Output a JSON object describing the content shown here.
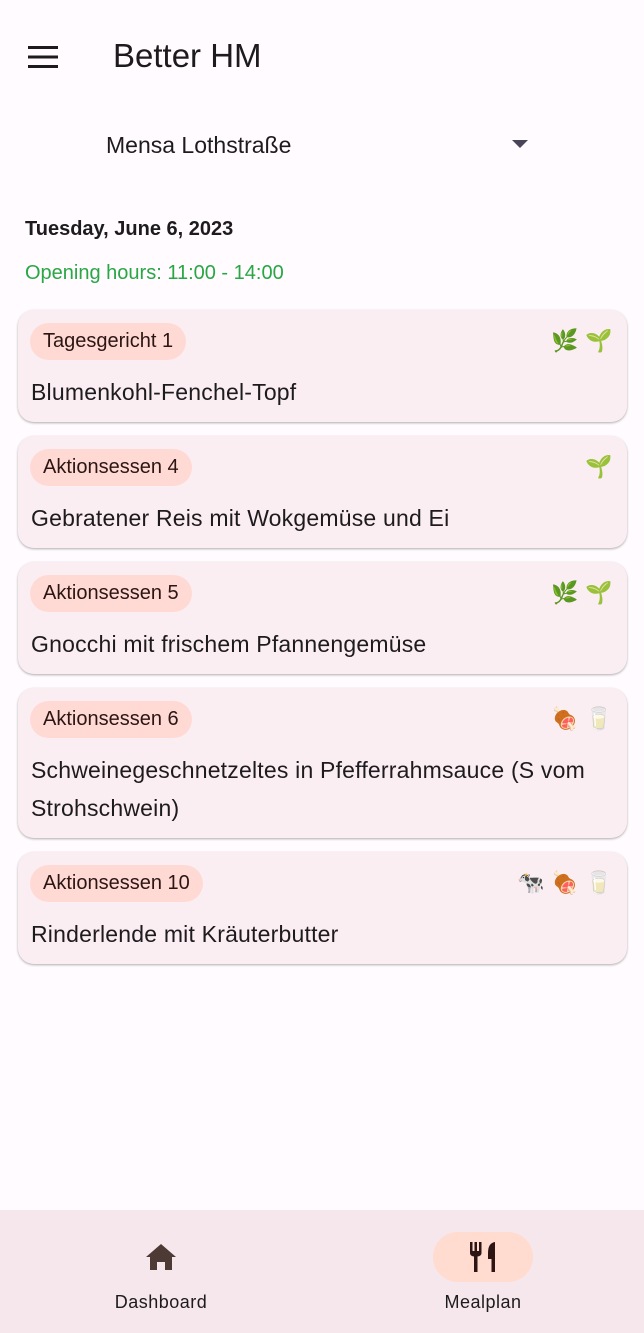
{
  "app": {
    "title": "Better HM"
  },
  "canteen_select": {
    "value": "Mensa Lothstraße"
  },
  "day": {
    "date": "Tuesday, June 6, 2023",
    "opening_hours": "Opening hours: 11:00 - 14:00"
  },
  "meals": [
    {
      "category": "Tagesgericht 1",
      "name": "Blumenkohl-Fenchel-Topf",
      "icons": [
        {
          "name": "herb-icon",
          "glyph": "🌿"
        },
        {
          "name": "seedling-icon",
          "glyph": "🌱"
        }
      ]
    },
    {
      "category": "Aktionsessen 4",
      "name": "Gebratener Reis mit Wokgemüse und Ei",
      "icons": [
        {
          "name": "seedling-icon",
          "glyph": "🌱"
        }
      ]
    },
    {
      "category": "Aktionsessen 5",
      "name": "Gnocchi mit frischem Pfannengemüse",
      "icons": [
        {
          "name": "herb-icon",
          "glyph": "🌿"
        },
        {
          "name": "seedling-icon",
          "glyph": "🌱"
        }
      ]
    },
    {
      "category": "Aktionsessen 6",
      "name": "Schweinegeschnetzeltes in Pfefferrahmsauce (S vom Strohschwein)",
      "icons": [
        {
          "name": "ham-icon",
          "glyph": "🍖"
        },
        {
          "name": "milk-glass-icon",
          "glyph": "🥛"
        }
      ]
    },
    {
      "category": "Aktionsessen 10",
      "name": "Rinderlende mit Kräuterbutter",
      "icons": [
        {
          "name": "cow-icon",
          "glyph": "🐄"
        },
        {
          "name": "ham-icon",
          "glyph": "🍖"
        },
        {
          "name": "milk-glass-icon",
          "glyph": "🥛"
        }
      ]
    }
  ],
  "bottom_nav": {
    "items": [
      {
        "label": "Dashboard",
        "icon": "home-icon",
        "active": false
      },
      {
        "label": "Mealplan",
        "icon": "restaurant-icon",
        "active": true
      }
    ]
  },
  "colors": {
    "background": "#fffbfe",
    "card": "#fbeef2",
    "badge": "#ffdad5",
    "opening_hours": "#28a745",
    "nav_bar": "#f6e7ec",
    "nav_active_indicator": "#ffdbd0"
  }
}
